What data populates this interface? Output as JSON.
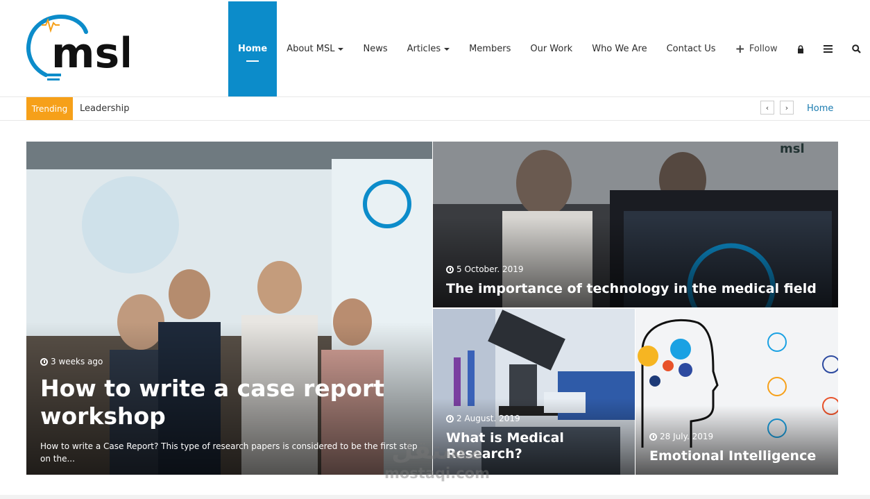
{
  "nav": {
    "items": [
      {
        "label": "Home",
        "active": true
      },
      {
        "label": "About MSL",
        "dropdown": true
      },
      {
        "label": "News"
      },
      {
        "label": "Articles",
        "dropdown": true
      },
      {
        "label": "Members"
      },
      {
        "label": "Our Work"
      },
      {
        "label": "Who We Are"
      },
      {
        "label": "Contact Us"
      }
    ],
    "follow_label": "Follow",
    "icons": [
      "plus-icon",
      "lock-icon",
      "menu-icon",
      "search-icon"
    ]
  },
  "trending": {
    "badge": "Trending",
    "headline": "Leadership",
    "prev_icon": "‹",
    "next_icon": "›",
    "breadcrumb": "Home"
  },
  "featured": [
    {
      "date": "3 weeks ago",
      "title": "How to write a case report workshop",
      "excerpt": "How to write a Case Report? This type of research papers is considered to be the first step on the..."
    },
    {
      "date": "5 October. 2019",
      "title": "The importance of technology in the medical field"
    },
    {
      "date": "2 August. 2019",
      "title": "What is Medical Research?"
    },
    {
      "date": "28 July. 2019",
      "title": "Emotional Intelligence"
    }
  ],
  "watermark": {
    "arabic": "مستقل",
    "latin": "mostaqi.com"
  },
  "colors": {
    "accent": "#0c8cca",
    "trending": "#f6a019",
    "link": "#1a7bb0"
  }
}
